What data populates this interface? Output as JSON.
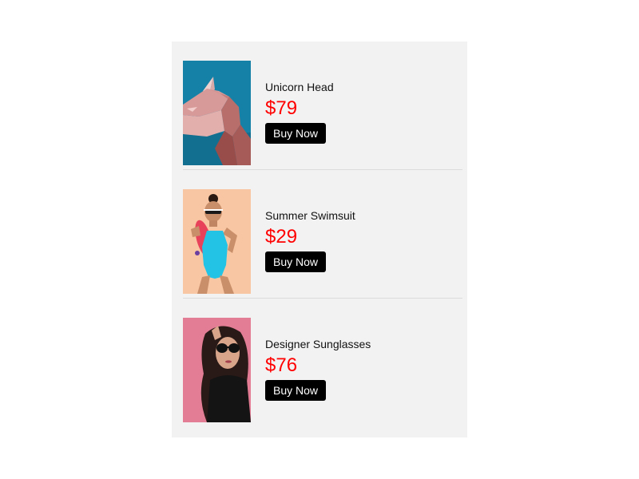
{
  "products": [
    {
      "name": "Unicorn Head",
      "price": "$79",
      "button_label": "Buy Now",
      "image": "unicorn-head-image",
      "bg_color": "#1a86a8"
    },
    {
      "name": "Summer Swimsuit",
      "price": "$29",
      "button_label": "Buy Now",
      "image": "swimsuit-image",
      "bg_color": "#f7c7a3"
    },
    {
      "name": "Designer Sunglasses",
      "price": "$76",
      "button_label": "Buy Now",
      "image": "sunglasses-image",
      "bg_color": "#e07c93"
    }
  ],
  "colors": {
    "price": "#ff0000",
    "button_bg": "#000000",
    "button_text": "#ffffff",
    "panel_bg": "#f2f2f2"
  }
}
